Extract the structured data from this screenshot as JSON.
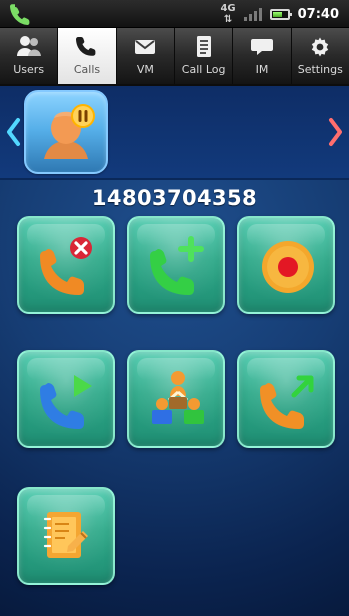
{
  "status_bar": {
    "network": "4G",
    "time": "07:40"
  },
  "tabs": [
    {
      "label": "Users",
      "icon": "users-icon",
      "active": false
    },
    {
      "label": "Calls",
      "icon": "phone-icon",
      "active": true
    },
    {
      "label": "VM",
      "icon": "voicemail-icon",
      "active": false
    },
    {
      "label": "Call Log",
      "icon": "call-log-icon",
      "active": false
    },
    {
      "label": "IM",
      "icon": "chat-icon",
      "active": false
    },
    {
      "label": "Settings",
      "icon": "gear-icon",
      "active": false
    }
  ],
  "contact": {
    "number": "14803704358",
    "status": "paused",
    "nav_left_icon": "chevron-left-icon",
    "nav_right_icon": "chevron-right-icon"
  },
  "actions": [
    {
      "name": "end-call-button",
      "icon": "end-call-icon"
    },
    {
      "name": "add-call-button",
      "icon": "add-call-icon"
    },
    {
      "name": "record-call-button",
      "icon": "record-icon"
    },
    {
      "name": "resume-call-button",
      "icon": "play-call-icon"
    },
    {
      "name": "conference-call-button",
      "icon": "conference-icon"
    },
    {
      "name": "transfer-call-button",
      "icon": "transfer-call-icon"
    },
    {
      "name": "notes-button",
      "icon": "notes-icon"
    }
  ],
  "colors": {
    "background": "#0b2450",
    "accent": "#2ea989",
    "avatar": "#55aee8",
    "chevron_left": "#52d8ff",
    "chevron_right": "#ff6e6e"
  }
}
